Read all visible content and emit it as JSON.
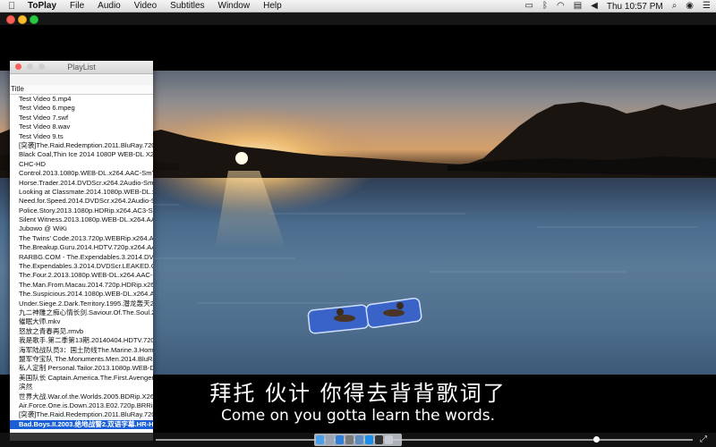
{
  "menubar": {
    "app_name": "ToPlay",
    "items": [
      "File",
      "Audio",
      "Video",
      "Subtitles",
      "Window",
      "Help"
    ],
    "clock": "Thu 10:57 PM",
    "tray_icons": [
      "battery-icon",
      "bluetooth-icon",
      "wifi-icon",
      "flag-icon",
      "volume-icon",
      "search-icon",
      "user-icon",
      "list-icon"
    ]
  },
  "playlist": {
    "title": "PlayList",
    "column_header": "Title",
    "items": [
      "Test Video 5.mp4",
      "Test Video 6.mpeg",
      "Test Video 7.swf",
      "Test Video 8.wav",
      "Test Video 9.ts",
      "[突袭]The.Raid.Redemption.2011.BluRay.720p",
      "Black Coal,Thin Ice 2014 1080P WEB-DL X26",
      "CHC-HD",
      "Control.2013.1080p.WEB-DL.x264.AAC-SmY",
      "Horse.Trader.2014.DVDScr.x264.2Audio-SmY",
      "Looking at Classmate.2014.1080p.WEB-DL.x",
      "Need.for.Speed.2014.DVDScr.x264.2Audio-Sr",
      "Police.Story.2013.1080p.HDRip.x264.AC3-Sm",
      "Silent Witness.2013.1080p.WEB-DL.x264.AA",
      "Jubowo @ WiKi",
      "The Twins' Code.2013.720p.WEBRip.x264.AA",
      "The.Breakup.Guru.2014.HDTV.720p.x264.AA",
      "RARBG.COM - The.Expendables.3.2014.DVD",
      "The.Expendables.3.2014.DVDScr.LEAKED.CLE",
      "The.Four.2.2013.1080p.WEB-DL.x264.AAC-S",
      "The.Man.From.Macau.2014.720p.HDRip.x264",
      "The.Suspicious.2014.1080p.WEB-DL.x264.AA",
      "Under.Siege.2.Dark.Territory.1995.潜龙轰天2.",
      "九二神雕之痴心情长剑.Saviour.Of.The.Soul.2.1",
      "催眠大师.mkv",
      "怒放之青春再见.rmvb",
      "我是歌手.第二季第13期.20140404.HDTV.720p.",
      "海军陆战队员3：国土防线The.Marine.3.Homefr",
      "盟军夺宝队 The.Monuments.Men.2014.BluRay",
      "私人定制 Personal.Tailor.2013.1080p.WEB-D",
      "美国队长 Captain.America.The.First.Avenger.2",
      "滨然",
      "世界大战.War.of.the.Worlds.2005.BDRip.X264.",
      "Air.Force.One.is.Down.2013.E02.720p.BRRip.",
      "[突袭]The.Raid.Redemption.2011.BluRay.720p",
      "Bad.Boys.II.2003.绝地战警2.双语字幕.HR-HD"
    ],
    "selected_index": 35
  },
  "subtitles": {
    "chinese": "拜托  伙计  你得去背背歌词了",
    "english": "Come on you gotta learn the words."
  },
  "controls": {
    "progress_fraction": 0.82,
    "fullscreen_icon": "⤢"
  },
  "colors": {
    "selection": "#1a5fd6",
    "traffic_red": "#fc5f57",
    "traffic_yellow": "#fdbb2e",
    "traffic_green": "#29c940"
  }
}
